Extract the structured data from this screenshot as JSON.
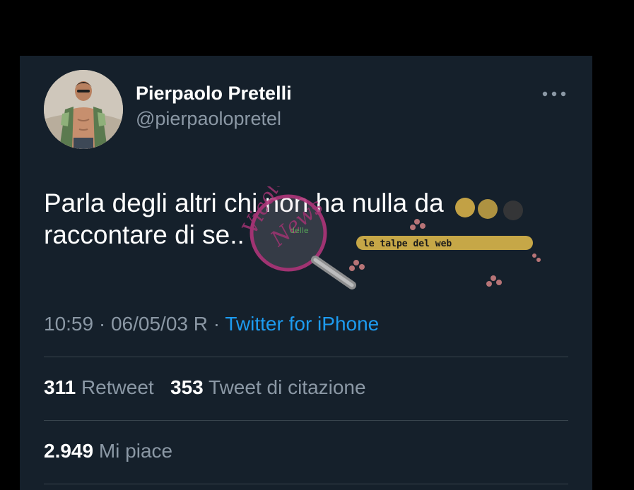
{
  "tweet": {
    "author_name": "Pierpaolo Pretelli",
    "author_handle": "@pierpaolopretel",
    "text": "Parla degli altri chi non ha nulla da\nraccontare di se..",
    "time": "10:59",
    "separator": " · ",
    "date": "06/05/03 R",
    "source": "Twitter for iPhone"
  },
  "stats": {
    "retweets_count": "311",
    "retweets_label": "Retweet",
    "quotes_count": "353",
    "quotes_label": "Tweet di citazione",
    "likes_count": "2.949",
    "likes_label": "Mi piace"
  },
  "watermark": {
    "magnifier_text": "Vicolo delle News",
    "banner_text": "le talpe del web"
  },
  "icons": {
    "more": "more-horizontal-icon",
    "avatar": "profile-photo"
  },
  "colors": {
    "background": "#15202b",
    "outer": "#000000",
    "primary_text": "#ffffff",
    "secondary_text": "#8b98a5",
    "accent": "#1d9bf0",
    "divider": "#38444d"
  }
}
